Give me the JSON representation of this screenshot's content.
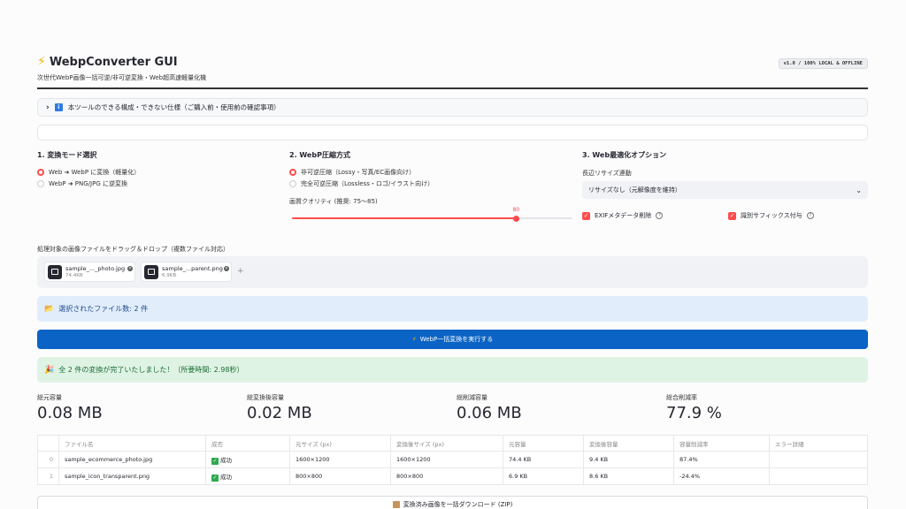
{
  "header": {
    "title": "WebpConverter GUI",
    "subtitle": "次世代WebP画像一括可逆/非可逆変換・Web超高速軽量化機",
    "version": "v1.0 / 100% LOCAL & OFFLINE"
  },
  "expander": {
    "label": "本ツールのできる構成・できない仕様（ご購入前・使用前の確認事項）"
  },
  "mode": {
    "heading": "1. 変換モード選択",
    "options": [
      "Web ➜ WebP に変換（軽量化）",
      "WebP ➜ PNG/JPG に逆変換"
    ],
    "selected": 0
  },
  "compression": {
    "heading": "2. WebP圧縮方式",
    "options": [
      "非可逆圧縮（Lossy・写真/EC画像向け）",
      "完全可逆圧縮（Lossless・ロゴ/イラスト向け）"
    ],
    "selected": 0,
    "quality_label": "画質クオリティ (推奨: 75〜85)",
    "quality_value": "80",
    "quality_min": 0,
    "quality_max": 100
  },
  "optimize": {
    "heading": "3. Web最適化オプション",
    "resize_label": "長辺リサイズ連動",
    "resize_value": "リサイズなし（元解像度を維持）",
    "exif_label": "EXIFメタデータ削除",
    "suffix_label": "識別サフィックス付与"
  },
  "upload": {
    "label": "処理対象の画像ファイルをドラッグ＆ドロップ（複数ファイル対応）",
    "files": [
      {
        "name": "sample_..._photo.jpg",
        "size": "74.4KB"
      },
      {
        "name": "sample_...parent.png",
        "size": "6.9KB"
      }
    ],
    "add": "+"
  },
  "selected_info": "選択されたファイル数: 2 件",
  "run_button": "WebP一括変換を実行する",
  "success_msg": "全 2 件の変換が完了いたしました！（所要時間: 2.98秒）",
  "metrics": [
    {
      "label": "総元容量",
      "value": "0.08 MB"
    },
    {
      "label": "総変換後容量",
      "value": "0.02 MB"
    },
    {
      "label": "総削減容量",
      "value": "0.06 MB"
    },
    {
      "label": "総合削減率",
      "value": "77.9 %"
    }
  ],
  "table": {
    "headers": [
      "",
      "ファイル名",
      "成否",
      "元サイズ (px)",
      "変換後サイズ (px)",
      "元容量",
      "変換後容量",
      "容量削減率",
      "エラー詳細"
    ],
    "rows": [
      [
        "0",
        "sample_ecommerce_photo.jpg",
        "成功",
        "1600×1200",
        "1600×1200",
        "74.4 KB",
        "9.4 KB",
        "87.4%",
        ""
      ],
      [
        "1",
        "sample_icon_transparent.png",
        "成功",
        "800×800",
        "800×800",
        "6.9 KB",
        "8.6 KB",
        "-24.4%",
        ""
      ]
    ]
  },
  "download_button": "変換済み画像を一括ダウンロード (ZIP)"
}
